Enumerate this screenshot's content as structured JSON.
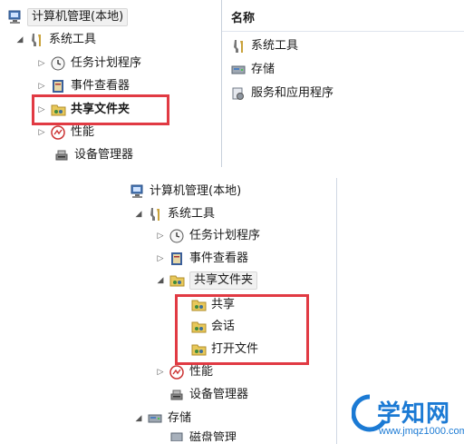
{
  "top_panel": {
    "root": "计算机管理(本地)",
    "system_tools": "系统工具",
    "items": [
      {
        "label": "任务计划程序",
        "icon": "clock-icon"
      },
      {
        "label": "事件查看器",
        "icon": "event-viewer-icon"
      },
      {
        "label": "共享文件夹",
        "icon": "shared-folder-icon"
      },
      {
        "label": "性能",
        "icon": "performance-icon"
      },
      {
        "label": "设备管理器",
        "icon": "device-manager-icon"
      }
    ],
    "right": {
      "header": "名称",
      "items": [
        {
          "label": "系统工具",
          "icon": "tools-icon"
        },
        {
          "label": "存储",
          "icon": "storage-icon"
        },
        {
          "label": "服务和应用程序",
          "icon": "services-icon"
        }
      ]
    }
  },
  "bottom_panel": {
    "root": "计算机管理(本地)",
    "system_tools": "系统工具",
    "items": [
      {
        "label": "任务计划程序"
      },
      {
        "label": "事件查看器"
      },
      {
        "label": "共享文件夹"
      }
    ],
    "children": [
      {
        "label": "共享"
      },
      {
        "label": "会话"
      },
      {
        "label": "打开文件"
      }
    ],
    "more": [
      {
        "label": "性能"
      },
      {
        "label": "设备管理器"
      }
    ],
    "storage": "存储",
    "cut_item": "磁盘管理"
  },
  "watermark": {
    "title": "学知网",
    "url": "www.jmqz1000.com"
  },
  "colors": {
    "highlight_border": "#e13a43",
    "watermark": "#1b7ad4"
  }
}
